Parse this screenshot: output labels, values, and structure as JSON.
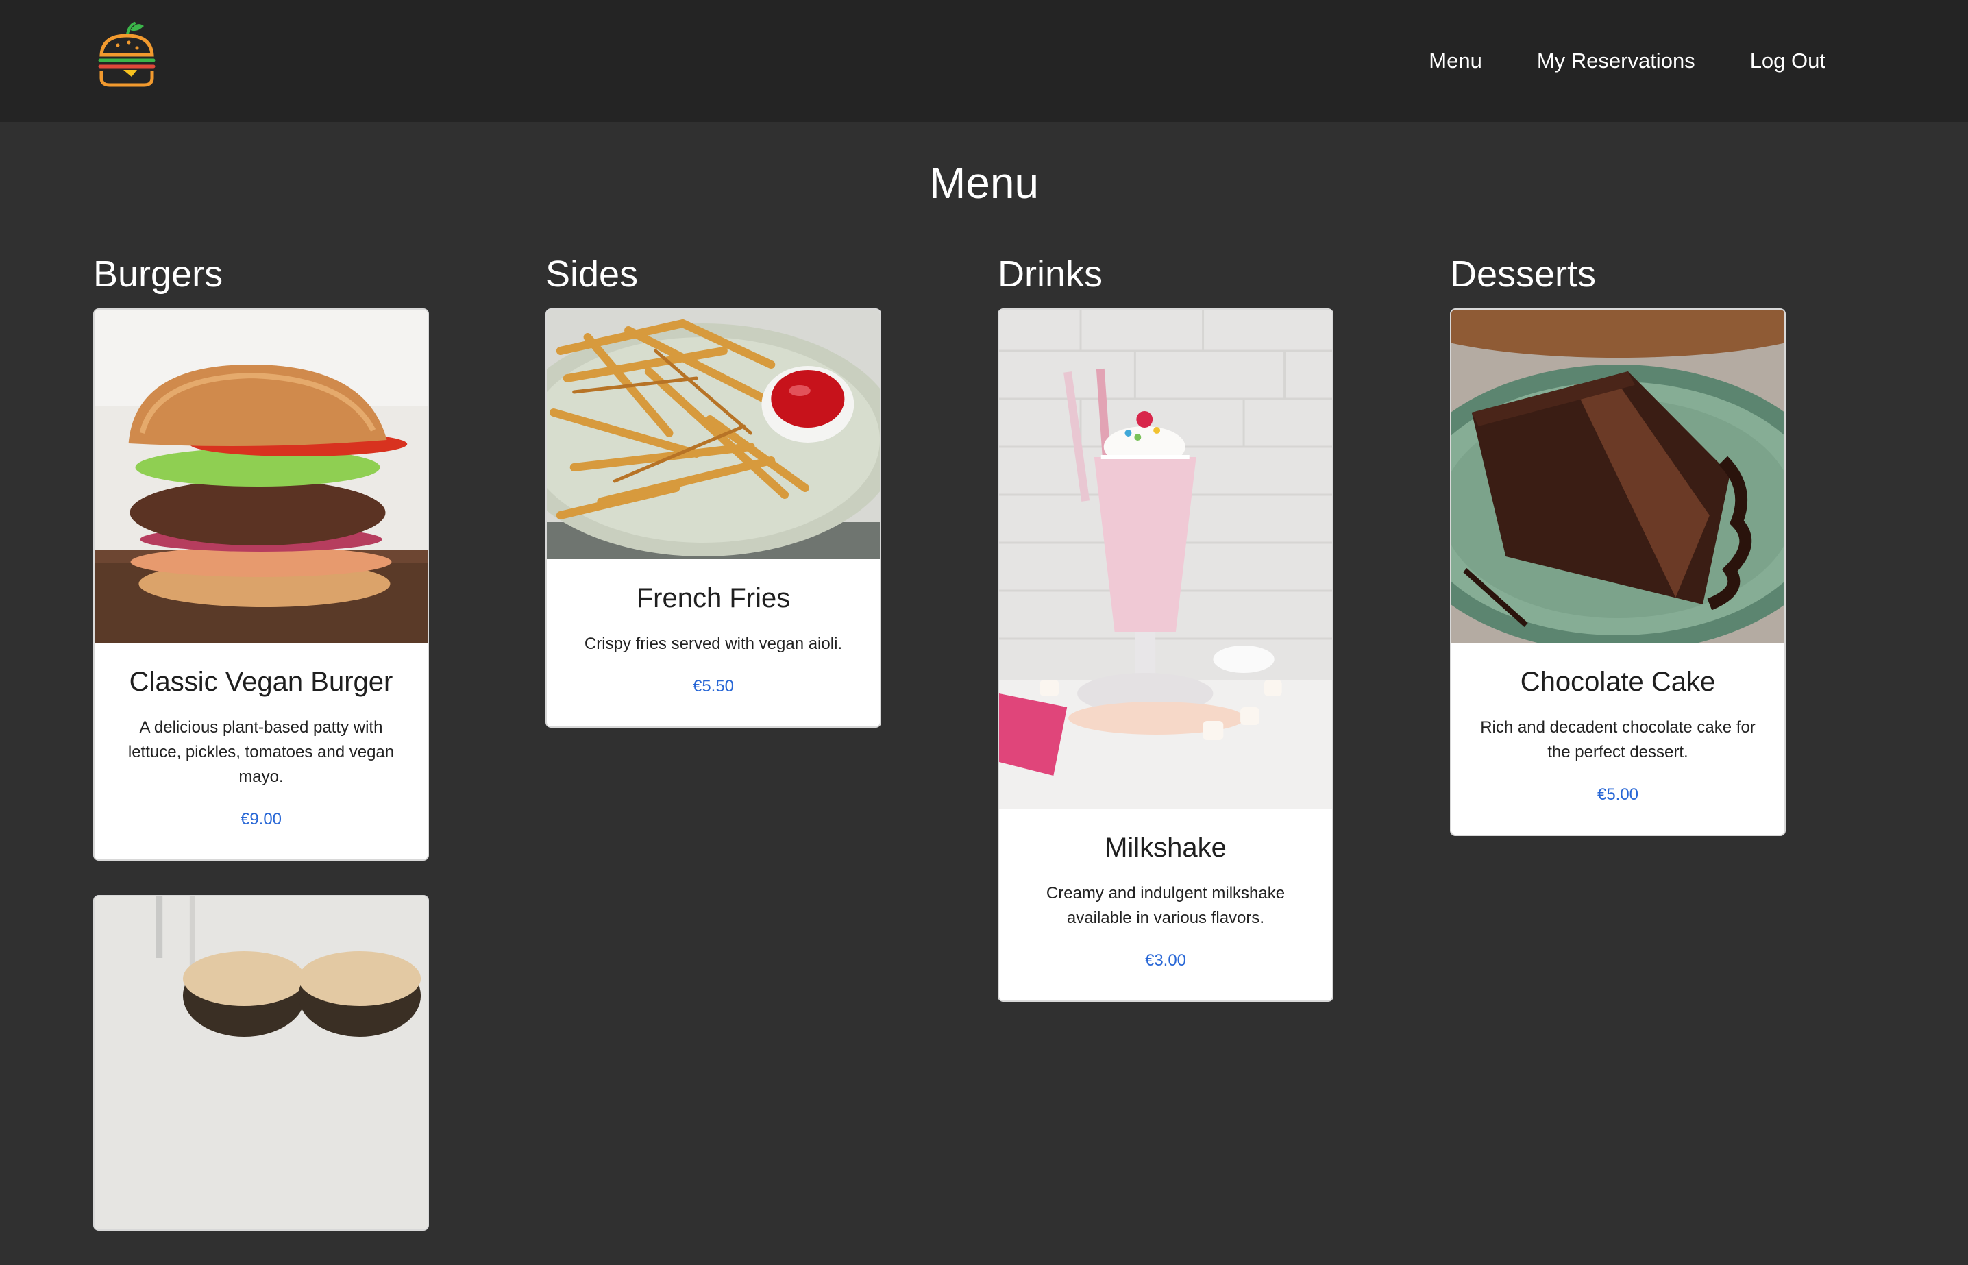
{
  "colors": {
    "navbar_bg": "#242424",
    "page_bg": "#303030",
    "price_accent": "#2867d6"
  },
  "navbar": {
    "logo_icon": "burger-logo-icon",
    "links": [
      "Menu",
      "My Reservations",
      "Log Out"
    ]
  },
  "page": {
    "title": "Menu"
  },
  "categories": [
    {
      "name": "Burgers",
      "items": [
        {
          "image_icon": "vegan-burger-photo",
          "title": "Classic Vegan Burger",
          "description": "A delicious plant-based patty with lettuce, pickles, tomatoes and vegan mayo.",
          "price": "€9.00"
        },
        {
          "image_icon": "burger-photo"
        }
      ]
    },
    {
      "name": "Sides",
      "items": [
        {
          "image_icon": "french-fries-photo",
          "title": "French Fries",
          "description": "Crispy fries served with vegan aioli.",
          "price": "€5.50"
        }
      ]
    },
    {
      "name": "Drinks",
      "items": [
        {
          "image_icon": "milkshake-photo",
          "title": "Milkshake",
          "description": "Creamy and indulgent milkshake available in various flavors.",
          "price": "€3.00"
        }
      ]
    },
    {
      "name": "Desserts",
      "items": [
        {
          "image_icon": "chocolate-cake-photo",
          "title": "Chocolate Cake",
          "description": "Rich and decadent chocolate cake for the perfect dessert.",
          "price": "€5.00"
        }
      ]
    }
  ]
}
